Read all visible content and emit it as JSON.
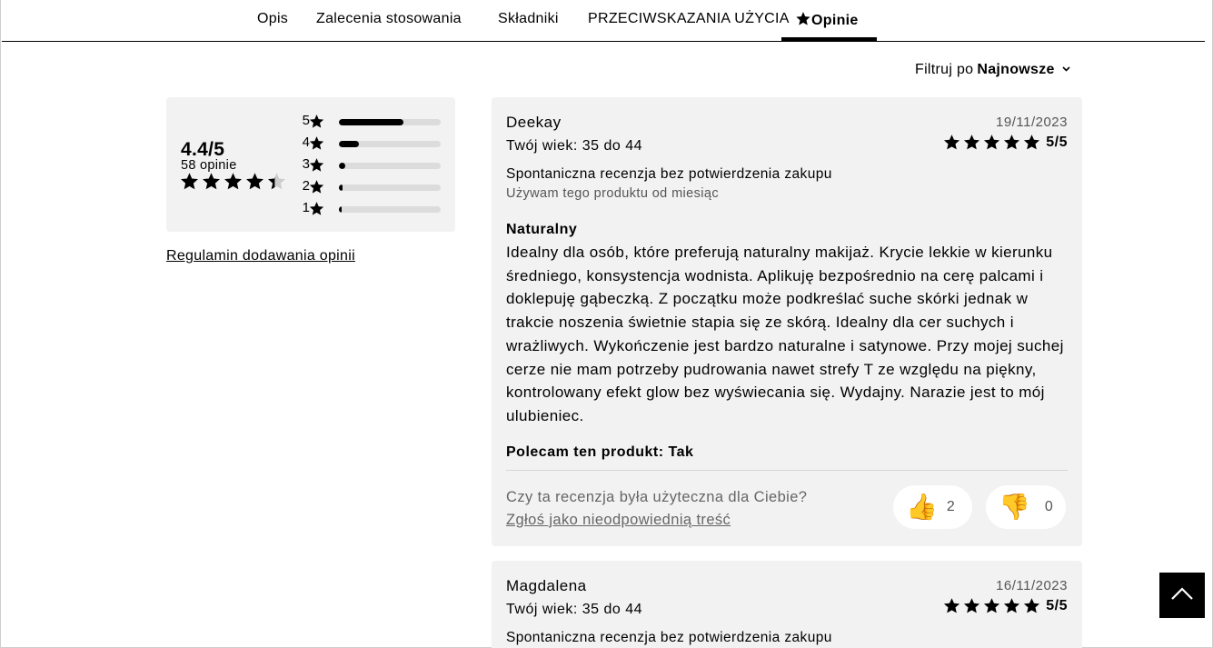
{
  "tabs": [
    {
      "label": "Opis"
    },
    {
      "label": "Zalecenia stosowania"
    },
    {
      "label": "Składniki"
    },
    {
      "label": "PRZECIWSKAZANIA UŻYCIA"
    },
    {
      "label": "Opinie",
      "active": true
    }
  ],
  "filter": {
    "label": "Filtruj po",
    "value": "Najnowsze"
  },
  "summary": {
    "average": "4.4/5",
    "count": "58 opinie",
    "average_stars": 4.4,
    "distribution": [
      {
        "stars": "5",
        "fraction": 0.63
      },
      {
        "stars": "4",
        "fraction": 0.2
      },
      {
        "stars": "3",
        "fraction": 0.06
      },
      {
        "stars": "2",
        "fraction": 0.04
      },
      {
        "stars": "1",
        "fraction": 0.03
      }
    ]
  },
  "rules_link": "Regulamin dodawania opinii",
  "reviews": [
    {
      "author": "Deekay",
      "age": "Twój wiek: 35 do 44",
      "date": "19/11/2023",
      "score": "5/5",
      "origin": "Spontaniczna recenzja bez potwierdzenia zakupu",
      "usage": "Używam tego produktu od miesiąc",
      "title": "Naturalny",
      "body": "Idealny dla osób, które preferują naturalny makijaż. Krycie lekkie w kierunku średniego, konsystencja wodnista. Aplikuję bezpośrednio na cerę palcami i doklepuję gąbeczką. Z początku może podkreślać suche skórki jednak w trakcie noszenia świetnie stapia się ze skórą. Idealny dla cer suchych i wrażliwych. Wykończenie jest bardzo naturalne i satynowe. Przy mojej suchej cerze nie mam potrzeby pudrowania nawet strefy T ze względu na piękny, kontrolowany efekt glow bez wyświecania się. Wydajny. Narazie jest to mój ulubieniec.",
      "recommend": "Polecam ten produkt: Tak",
      "helpful_question": "Czy ta recenzja była użyteczna dla Ciebie?",
      "report": "Zgłoś jako nieodpowiednią treść",
      "upvotes": "2",
      "downvotes": "0"
    },
    {
      "author": "Magdalena",
      "age": "Twój wiek: 35 do 44",
      "date": "16/11/2023",
      "score": "5/5",
      "origin": "Spontaniczna recenzja bez potwierdzenia zakupu"
    }
  ],
  "icons": {
    "up": "thumbs-up-icon",
    "down": "thumbs-down-icon",
    "top": "scroll-to-top-icon",
    "star": "star-icon"
  },
  "colors": {
    "accent": "#000000",
    "card": "#f2f2f2",
    "star_empty": "#cccccc"
  }
}
